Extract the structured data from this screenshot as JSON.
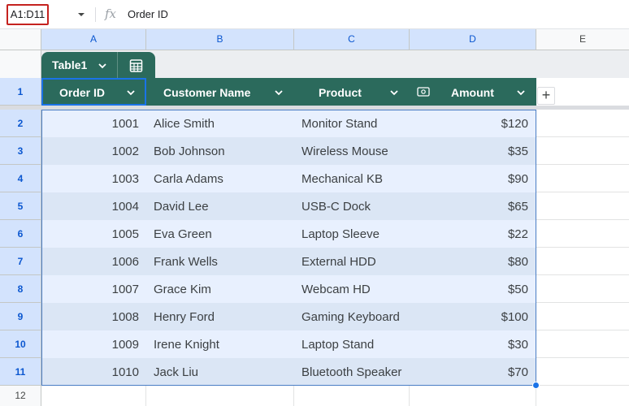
{
  "formula_bar": {
    "name_box": "A1:D11",
    "fx_label": "fx",
    "value": "Order ID"
  },
  "columns": [
    "A",
    "B",
    "C",
    "D",
    "E"
  ],
  "table_tab": {
    "name": "Table1",
    "icons": [
      "chevron-down-icon",
      "table-settings-icon"
    ]
  },
  "table_header": {
    "cols": [
      {
        "label": "Order ID",
        "icon": "chevron-down-icon"
      },
      {
        "label": "Customer Name",
        "icon": "chevron-down-icon"
      },
      {
        "label": "Product",
        "icon": "chevron-down-icon"
      },
      {
        "label": "Amount",
        "icon": "chevron-down-icon",
        "type_icon": "currency-icon"
      }
    ],
    "add_column": "+"
  },
  "rows": [
    {
      "num": "2",
      "id": "1001",
      "name": "Alice Smith",
      "product": "Monitor Stand",
      "amount": "$120"
    },
    {
      "num": "3",
      "id": "1002",
      "name": "Bob Johnson",
      "product": "Wireless Mouse",
      "amount": "$35"
    },
    {
      "num": "4",
      "id": "1003",
      "name": "Carla Adams",
      "product": "Mechanical KB",
      "amount": "$90"
    },
    {
      "num": "5",
      "id": "1004",
      "name": "David Lee",
      "product": "USB-C Dock",
      "amount": "$65"
    },
    {
      "num": "6",
      "id": "1005",
      "name": "Eva Green",
      "product": "Laptop Sleeve",
      "amount": "$22"
    },
    {
      "num": "7",
      "id": "1006",
      "name": "Frank Wells",
      "product": "External HDD",
      "amount": "$80"
    },
    {
      "num": "8",
      "id": "1007",
      "name": "Grace Kim",
      "product": "Webcam HD",
      "amount": "$50"
    },
    {
      "num": "9",
      "id": "1008",
      "name": "Henry Ford",
      "product": "Gaming Keyboard",
      "amount": "$100"
    },
    {
      "num": "10",
      "id": "1009",
      "name": "Irene Knight",
      "product": "Laptop Stand",
      "amount": "$30"
    },
    {
      "num": "11",
      "id": "1010",
      "name": "Jack Liu",
      "product": "Bluetooth Speaker",
      "amount": "$70"
    }
  ],
  "row_header_1": "1",
  "row_header_12": "12",
  "colors": {
    "table_header_bg": "#2b6a5c",
    "row_band_1": "#e8f0fe",
    "row_band_2": "#dbe6f5",
    "selection_border": "#1a73e8",
    "name_box_border": "#c5221f"
  }
}
